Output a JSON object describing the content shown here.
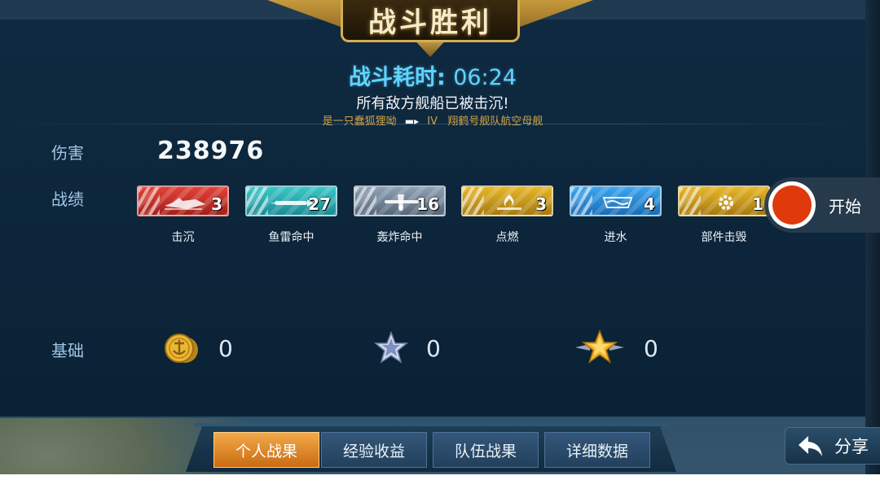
{
  "banner": {
    "title": "战斗胜利"
  },
  "header": {
    "duration_label": "战斗耗时:",
    "duration_value": "06:24",
    "message": "所有敌方舰船已被击沉!",
    "player_name": "是一只蠢狐狸呦",
    "ship_tier": "IV",
    "ship_name": "翔鹤号舰队航空母舰"
  },
  "stats": {
    "damage_label": "伤害",
    "damage_value": "238976",
    "record_label": "战绩",
    "base_label": "基础"
  },
  "medals": [
    {
      "label": "击沉",
      "count": "3",
      "color": "#c8302a",
      "icon": "ship-sunk-icon"
    },
    {
      "label": "鱼雷命中",
      "count": "27",
      "color": "#27a7ad",
      "icon": "torpedo-icon"
    },
    {
      "label": "轰炸命中",
      "count": "16",
      "color": "#6f8296",
      "icon": "bomber-icon"
    },
    {
      "label": "点燃",
      "count": "3",
      "color": "#c8971a",
      "icon": "fire-icon"
    },
    {
      "label": "进水",
      "count": "4",
      "color": "#2a88d4",
      "icon": "flooding-icon"
    },
    {
      "label": "部件击毁",
      "count": "1",
      "color": "#c8971a",
      "icon": "gear-icon"
    }
  ],
  "base_rewards": [
    {
      "icon": "coin-icon",
      "value": "0"
    },
    {
      "icon": "silver-star-icon",
      "value": "0"
    },
    {
      "icon": "gold-star-icon",
      "value": "0"
    }
  ],
  "recorder": {
    "label": "开始",
    "button_color": "#e0390c"
  },
  "tabs": [
    {
      "label": "个人战果",
      "active": true
    },
    {
      "label": "经验收益",
      "active": false
    },
    {
      "label": "队伍战果",
      "active": false
    },
    {
      "label": "详细数据",
      "active": false
    }
  ],
  "share": {
    "label": "分享"
  },
  "colors": {
    "accent_cyan": "#5fd4ff",
    "gold": "#d0a24a",
    "active_tab": "#e08a2a"
  }
}
